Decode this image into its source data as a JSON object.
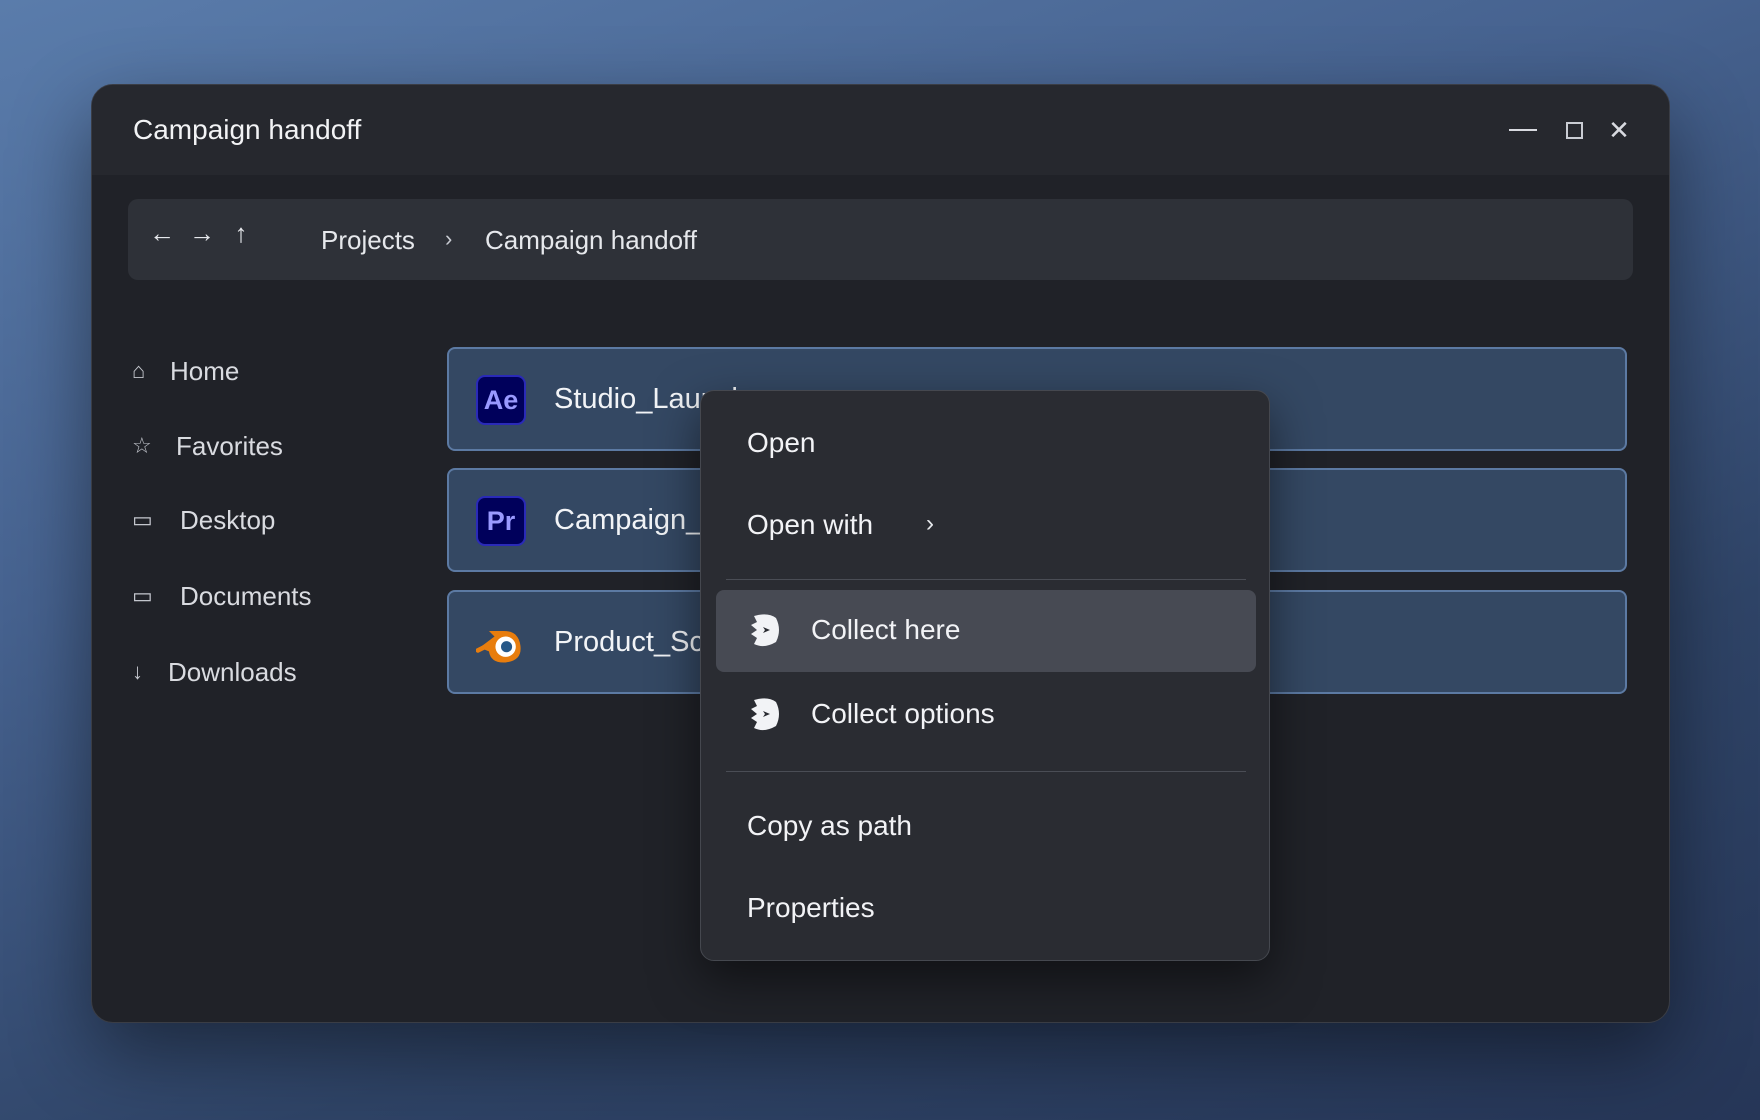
{
  "window": {
    "title": "Campaign handoff",
    "controls": {
      "minimize": "",
      "maximize": "",
      "close": "✕"
    }
  },
  "addressbar": {
    "back": "←",
    "forward": "→",
    "up": "↑",
    "breadcrumbs": [
      "Projects",
      "Campaign handoff"
    ],
    "separator": "›"
  },
  "sidebar": {
    "items": [
      {
        "label": "Home",
        "icon": "⌂",
        "icon_name": "home-icon"
      },
      {
        "label": "Favorites",
        "icon": "☆",
        "icon_name": "star-icon"
      },
      {
        "label": "Desktop",
        "icon": "▭",
        "icon_name": "desktop-icon"
      },
      {
        "label": "Documents",
        "icon": "▭",
        "icon_name": "documents-icon"
      },
      {
        "label": "Downloads",
        "icon": "↓",
        "icon_name": "downloads-icon"
      }
    ]
  },
  "files": [
    {
      "name": "Studio_Launch.aep",
      "icon_text": "Ae",
      "icon_name": "after-effects-icon"
    },
    {
      "name": "Campaign_Edit",
      "icon_text": "Pr",
      "icon_name": "premiere-icon"
    },
    {
      "name": "Product_Scene",
      "icon_text": "",
      "icon_name": "blender-icon"
    }
  ],
  "context_menu": {
    "open": "Open",
    "open_with": "Open with",
    "open_with_chevron": "›",
    "collect_here": "Collect here",
    "collect_options": "Collect options",
    "copy_as_path": "Copy as path",
    "properties": "Properties",
    "highlighted": "Collect here"
  },
  "colors": {
    "accent_row": "#344863",
    "row_border": "#5c7aa3",
    "blender_orange": "#e87d0d",
    "blender_blue": "#265787"
  }
}
